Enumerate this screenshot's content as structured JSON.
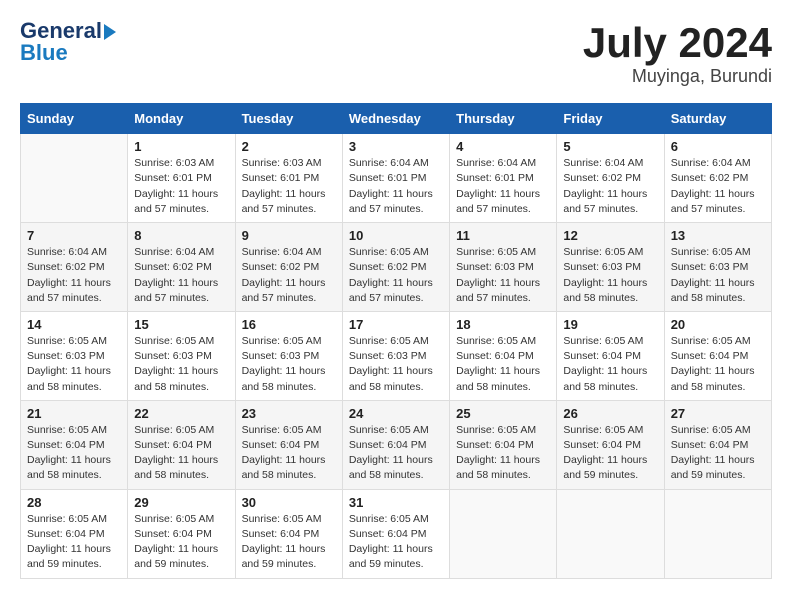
{
  "header": {
    "logo_line1": "General",
    "logo_line2": "Blue",
    "month": "July 2024",
    "location": "Muyinga, Burundi"
  },
  "days_of_week": [
    "Sunday",
    "Monday",
    "Tuesday",
    "Wednesday",
    "Thursday",
    "Friday",
    "Saturday"
  ],
  "weeks": [
    [
      {
        "day": "",
        "info": ""
      },
      {
        "day": "1",
        "info": "Sunrise: 6:03 AM\nSunset: 6:01 PM\nDaylight: 11 hours\nand 57 minutes."
      },
      {
        "day": "2",
        "info": "Sunrise: 6:03 AM\nSunset: 6:01 PM\nDaylight: 11 hours\nand 57 minutes."
      },
      {
        "day": "3",
        "info": "Sunrise: 6:04 AM\nSunset: 6:01 PM\nDaylight: 11 hours\nand 57 minutes."
      },
      {
        "day": "4",
        "info": "Sunrise: 6:04 AM\nSunset: 6:01 PM\nDaylight: 11 hours\nand 57 minutes."
      },
      {
        "day": "5",
        "info": "Sunrise: 6:04 AM\nSunset: 6:02 PM\nDaylight: 11 hours\nand 57 minutes."
      },
      {
        "day": "6",
        "info": "Sunrise: 6:04 AM\nSunset: 6:02 PM\nDaylight: 11 hours\nand 57 minutes."
      }
    ],
    [
      {
        "day": "7",
        "info": "Sunrise: 6:04 AM\nSunset: 6:02 PM\nDaylight: 11 hours\nand 57 minutes."
      },
      {
        "day": "8",
        "info": "Sunrise: 6:04 AM\nSunset: 6:02 PM\nDaylight: 11 hours\nand 57 minutes."
      },
      {
        "day": "9",
        "info": "Sunrise: 6:04 AM\nSunset: 6:02 PM\nDaylight: 11 hours\nand 57 minutes."
      },
      {
        "day": "10",
        "info": "Sunrise: 6:05 AM\nSunset: 6:02 PM\nDaylight: 11 hours\nand 57 minutes."
      },
      {
        "day": "11",
        "info": "Sunrise: 6:05 AM\nSunset: 6:03 PM\nDaylight: 11 hours\nand 57 minutes."
      },
      {
        "day": "12",
        "info": "Sunrise: 6:05 AM\nSunset: 6:03 PM\nDaylight: 11 hours\nand 58 minutes."
      },
      {
        "day": "13",
        "info": "Sunrise: 6:05 AM\nSunset: 6:03 PM\nDaylight: 11 hours\nand 58 minutes."
      }
    ],
    [
      {
        "day": "14",
        "info": "Sunrise: 6:05 AM\nSunset: 6:03 PM\nDaylight: 11 hours\nand 58 minutes."
      },
      {
        "day": "15",
        "info": "Sunrise: 6:05 AM\nSunset: 6:03 PM\nDaylight: 11 hours\nand 58 minutes."
      },
      {
        "day": "16",
        "info": "Sunrise: 6:05 AM\nSunset: 6:03 PM\nDaylight: 11 hours\nand 58 minutes."
      },
      {
        "day": "17",
        "info": "Sunrise: 6:05 AM\nSunset: 6:03 PM\nDaylight: 11 hours\nand 58 minutes."
      },
      {
        "day": "18",
        "info": "Sunrise: 6:05 AM\nSunset: 6:04 PM\nDaylight: 11 hours\nand 58 minutes."
      },
      {
        "day": "19",
        "info": "Sunrise: 6:05 AM\nSunset: 6:04 PM\nDaylight: 11 hours\nand 58 minutes."
      },
      {
        "day": "20",
        "info": "Sunrise: 6:05 AM\nSunset: 6:04 PM\nDaylight: 11 hours\nand 58 minutes."
      }
    ],
    [
      {
        "day": "21",
        "info": "Sunrise: 6:05 AM\nSunset: 6:04 PM\nDaylight: 11 hours\nand 58 minutes."
      },
      {
        "day": "22",
        "info": "Sunrise: 6:05 AM\nSunset: 6:04 PM\nDaylight: 11 hours\nand 58 minutes."
      },
      {
        "day": "23",
        "info": "Sunrise: 6:05 AM\nSunset: 6:04 PM\nDaylight: 11 hours\nand 58 minutes."
      },
      {
        "day": "24",
        "info": "Sunrise: 6:05 AM\nSunset: 6:04 PM\nDaylight: 11 hours\nand 58 minutes."
      },
      {
        "day": "25",
        "info": "Sunrise: 6:05 AM\nSunset: 6:04 PM\nDaylight: 11 hours\nand 58 minutes."
      },
      {
        "day": "26",
        "info": "Sunrise: 6:05 AM\nSunset: 6:04 PM\nDaylight: 11 hours\nand 59 minutes."
      },
      {
        "day": "27",
        "info": "Sunrise: 6:05 AM\nSunset: 6:04 PM\nDaylight: 11 hours\nand 59 minutes."
      }
    ],
    [
      {
        "day": "28",
        "info": "Sunrise: 6:05 AM\nSunset: 6:04 PM\nDaylight: 11 hours\nand 59 minutes."
      },
      {
        "day": "29",
        "info": "Sunrise: 6:05 AM\nSunset: 6:04 PM\nDaylight: 11 hours\nand 59 minutes."
      },
      {
        "day": "30",
        "info": "Sunrise: 6:05 AM\nSunset: 6:04 PM\nDaylight: 11 hours\nand 59 minutes."
      },
      {
        "day": "31",
        "info": "Sunrise: 6:05 AM\nSunset: 6:04 PM\nDaylight: 11 hours\nand 59 minutes."
      },
      {
        "day": "",
        "info": ""
      },
      {
        "day": "",
        "info": ""
      },
      {
        "day": "",
        "info": ""
      }
    ]
  ]
}
